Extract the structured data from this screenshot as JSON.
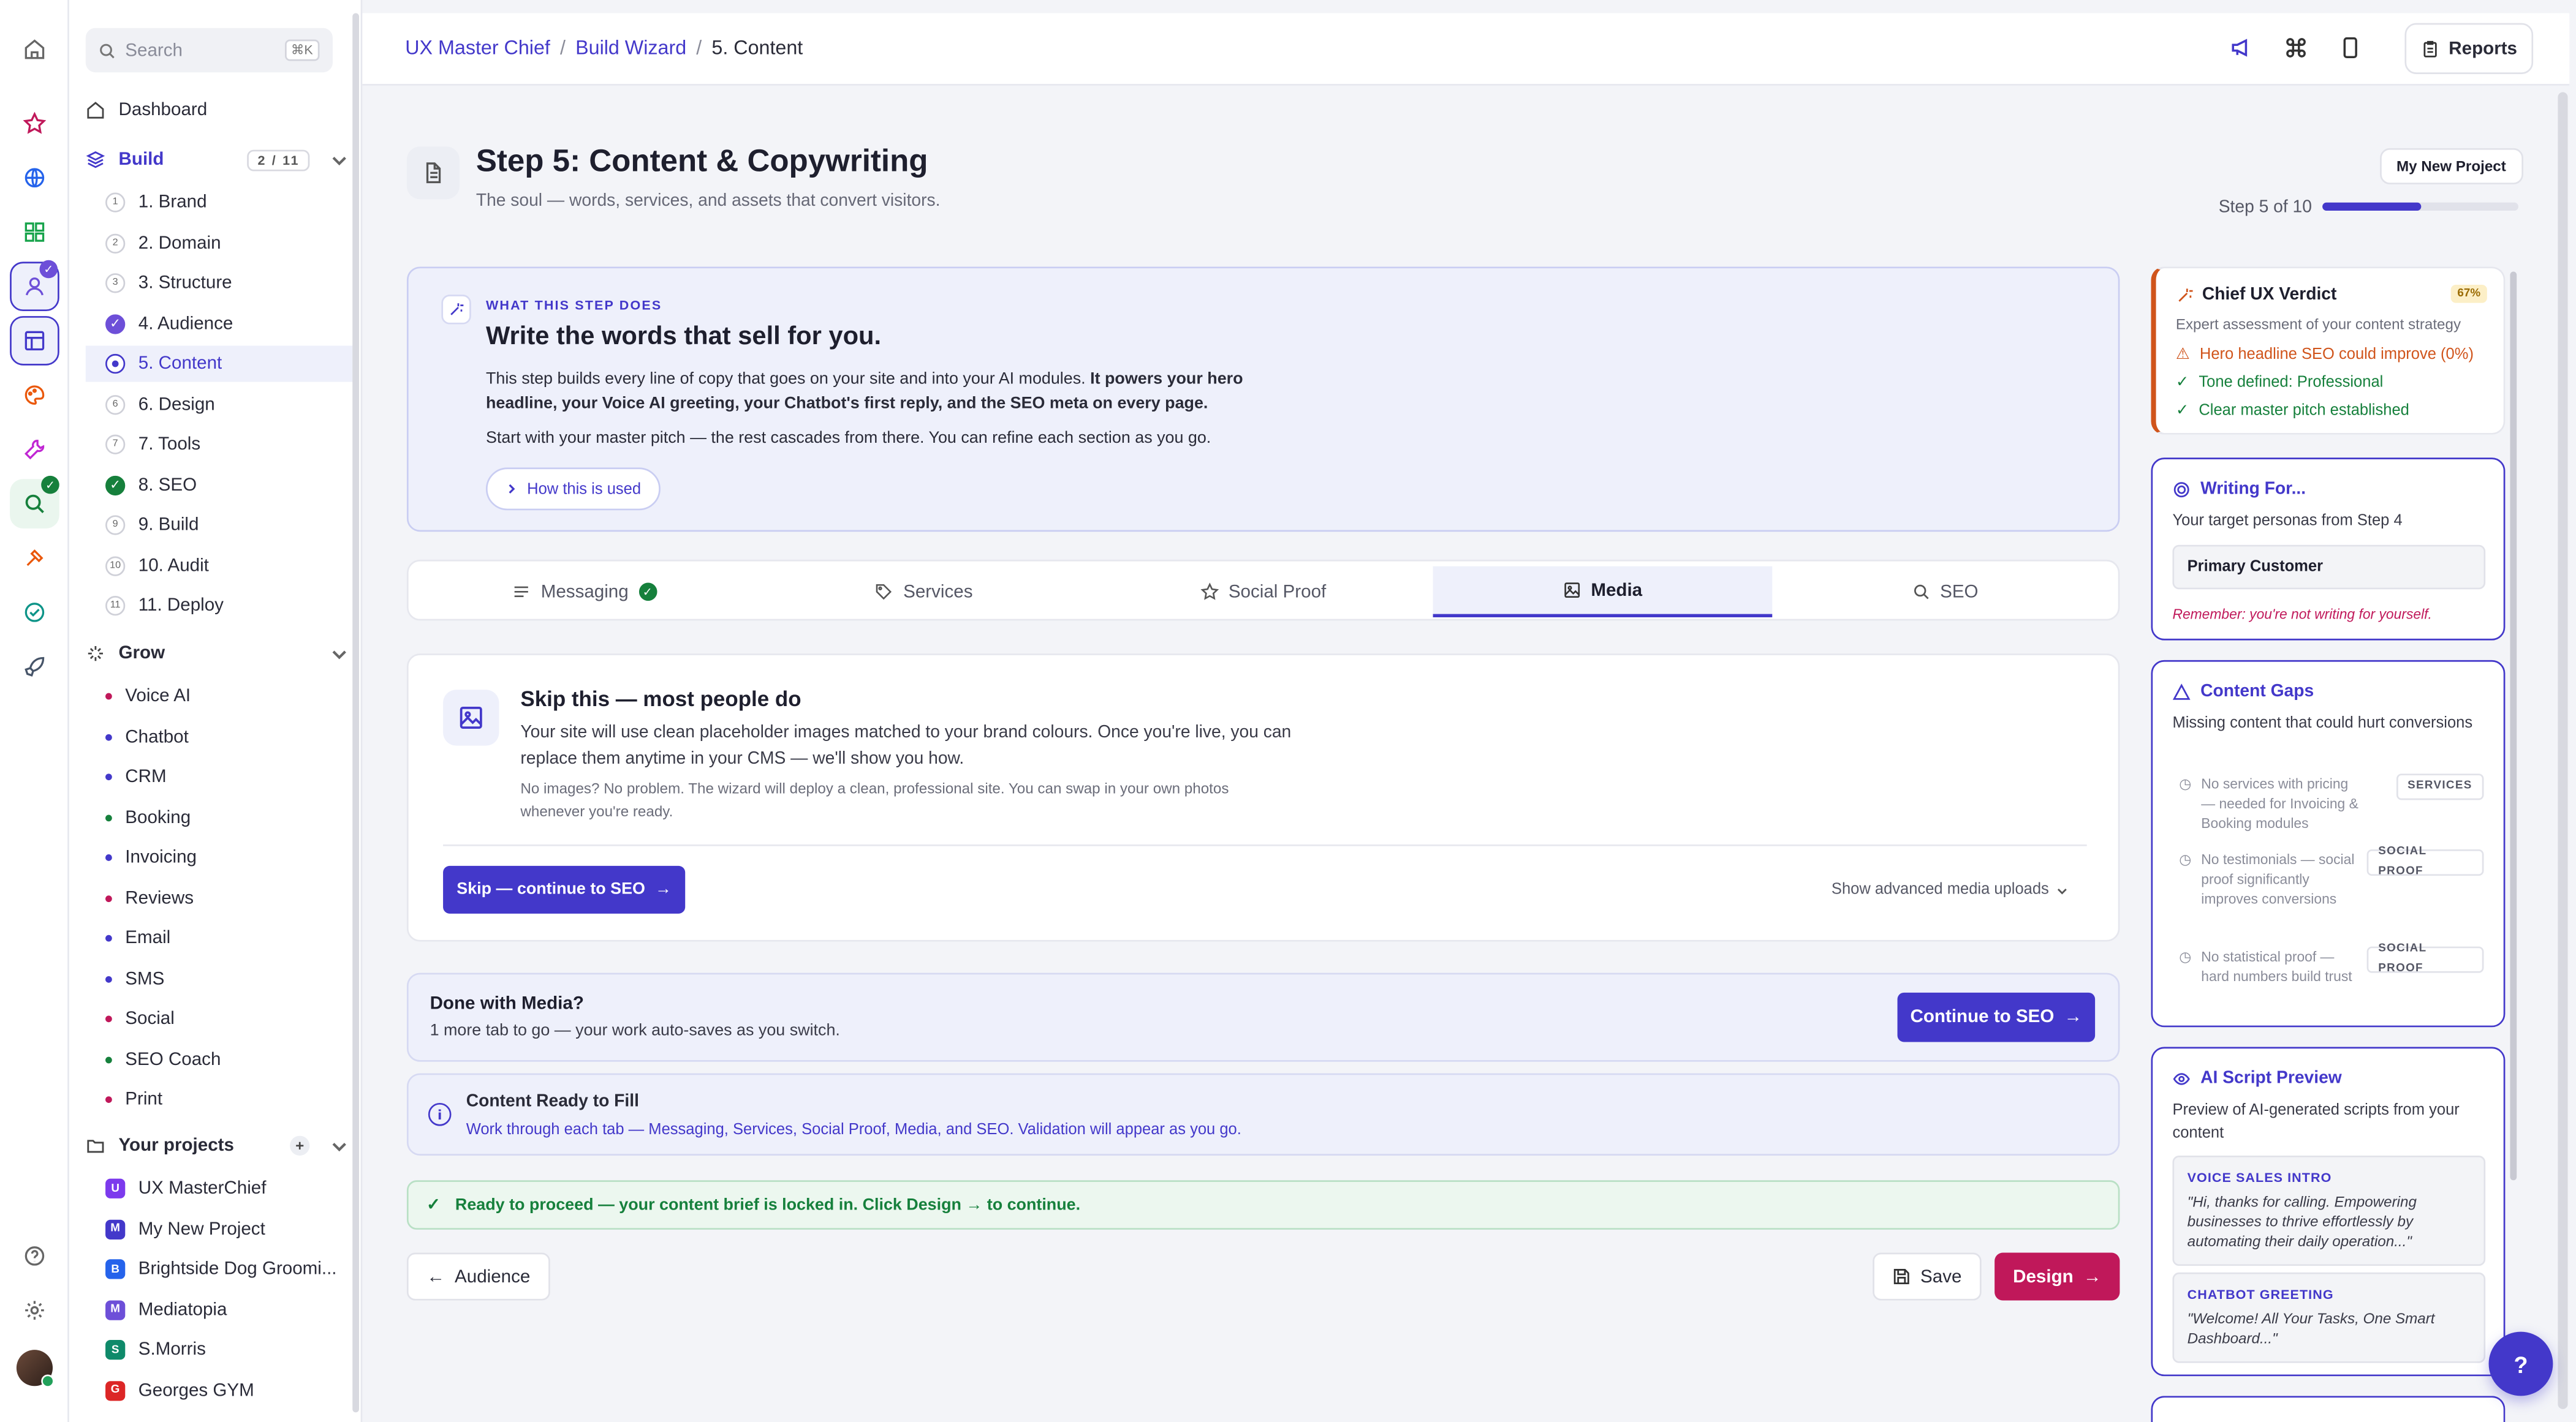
{
  "colors": {
    "accent": "#4338ca",
    "success": "#16803c",
    "danger": "#c0185a",
    "warning": "#d0541b",
    "bg": "#f3f4f8"
  },
  "search": {
    "placeholder": "Search",
    "shortcut": "⌘K"
  },
  "sidebar": {
    "dashboard": "Dashboard",
    "build": {
      "label": "Build",
      "count": "2 / 11"
    },
    "steps": [
      {
        "num": "1",
        "label": "1. Brand",
        "state": "todo"
      },
      {
        "num": "2",
        "label": "2. Domain",
        "state": "todo"
      },
      {
        "num": "3",
        "label": "3. Structure",
        "state": "todo"
      },
      {
        "num": "✓",
        "label": "4. Audience",
        "state": "done"
      },
      {
        "num": "",
        "label": "5. Content",
        "state": "current"
      },
      {
        "num": "6",
        "label": "6. Design",
        "state": "todo"
      },
      {
        "num": "7",
        "label": "7. Tools",
        "state": "todo"
      },
      {
        "num": "✓",
        "label": "8. SEO",
        "state": "done-green"
      },
      {
        "num": "9",
        "label": "9. Build",
        "state": "todo"
      },
      {
        "num": "10",
        "label": "10. Audit",
        "state": "todo"
      },
      {
        "num": "11",
        "label": "11. Deploy",
        "state": "todo"
      }
    ],
    "grow": {
      "label": "Grow",
      "items": [
        {
          "label": "Voice AI",
          "color": "#c0185a"
        },
        {
          "label": "Chatbot",
          "color": "#4338ca"
        },
        {
          "label": "CRM",
          "color": "#4338ca"
        },
        {
          "label": "Booking",
          "color": "#16803c"
        },
        {
          "label": "Invoicing",
          "color": "#4338ca"
        },
        {
          "label": "Reviews",
          "color": "#c0185a"
        },
        {
          "label": "Email",
          "color": "#4338ca"
        },
        {
          "label": "SMS",
          "color": "#4338ca"
        },
        {
          "label": "Social",
          "color": "#c0185a"
        },
        {
          "label": "SEO Coach",
          "color": "#16803c"
        },
        {
          "label": "Print",
          "color": "#c0185a"
        }
      ]
    },
    "projects": {
      "label": "Your projects",
      "add": "+",
      "items": [
        {
          "initial": "U",
          "label": "UX MasterChief",
          "color": "#7c3aed"
        },
        {
          "initial": "M",
          "label": "My New Project",
          "color": "#4338ca"
        },
        {
          "initial": "B",
          "label": "Brightside Dog Groomi...",
          "color": "#2563eb"
        },
        {
          "initial": "M",
          "label": "Mediatopia",
          "color": "#6d4fd8"
        },
        {
          "initial": "S",
          "label": "S.Morris",
          "color": "#0f8a6a"
        },
        {
          "initial": "G",
          "label": "Georges GYM",
          "color": "#dc2626"
        }
      ]
    }
  },
  "breadcrumb": {
    "root": "UX Master Chief",
    "mid": "Build Wizard",
    "current": "5. Content",
    "sep": "/"
  },
  "topbar": {
    "reports": "Reports"
  },
  "header": {
    "title": "Step 5: Content & Copywriting",
    "subtitle": "The soul — words, services, and assets that convert visitors.",
    "project": "My New Project",
    "step_of": "Step 5 of 10",
    "progress": 0.5
  },
  "info": {
    "eyebrow": "WHAT THIS STEP DOES",
    "title": "Write the words that sell for you.",
    "p1_start": "This step builds every line of copy that goes on your site and into your AI modules. ",
    "p1_bold": "It powers your hero headline, your Voice AI greeting, your Chatbot's first reply, and the SEO meta on every page.",
    "p2": "Start with your master pitch — the rest cascades from there. You can refine each section as you go.",
    "how": "How this is used"
  },
  "tabs": [
    {
      "label": "Messaging",
      "icon": "lines-icon",
      "checked": true
    },
    {
      "label": "Services",
      "icon": "tag-icon"
    },
    {
      "label": "Social Proof",
      "icon": "star-icon"
    },
    {
      "label": "Media",
      "icon": "image-icon",
      "active": true
    },
    {
      "label": "SEO",
      "icon": "search-icon"
    }
  ],
  "media": {
    "title": "Skip this — most people do",
    "p": "Your site will use clean placeholder images matched to your brand colours. Once you're live, you can replace them anytime in your CMS — we'll show you how.",
    "p2": "No images? No problem. The wizard will deploy a clean, professional site. You can swap in your own photos whenever you're ready.",
    "skip": "Skip — continue to SEO",
    "advanced": "Show advanced media uploads"
  },
  "done": {
    "title": "Done with Media?",
    "sub": "1 more tab to go — your work auto-saves as you switch.",
    "cta": "Continue to SEO"
  },
  "ready": {
    "title": "Content Ready to Fill",
    "sub": "Work through each tab — Messaging, Services, Social Proof, Media, and SEO. Validation will appear as you go."
  },
  "proceed": "Ready to proceed — your content brief is locked in. Click Design → to continue.",
  "footer": {
    "back": "Audience",
    "save": "Save",
    "next": "Design"
  },
  "verdict": {
    "title": "Chief UX Verdict",
    "pct": "67%",
    "sub": "Expert assessment of your content strategy",
    "items": [
      {
        "text": "Hero headline SEO could improve (0%)",
        "type": "warn"
      },
      {
        "text": "Tone defined: Professional",
        "type": "ok"
      },
      {
        "text": "Clear master pitch established",
        "type": "ok"
      }
    ]
  },
  "writing": {
    "title": "Writing For...",
    "sub": "Your target personas from Step 4",
    "persona": "Primary Customer",
    "remind": "Remember: you're not writing for yourself."
  },
  "gaps": {
    "title": "Content Gaps",
    "sub": "Missing content that could hurt conversions",
    "items": [
      {
        "text": "No services with pricing — needed for Invoicing & Booking modules",
        "tag": "SERVICES"
      },
      {
        "text": "No testimonials — social proof significantly improves conversions",
        "tag": "SOCIAL PROOF"
      },
      {
        "text": "No statistical proof — hard numbers build trust",
        "tag": "SOCIAL PROOF"
      }
    ]
  },
  "ai": {
    "title": "AI Script Preview",
    "sub": "Preview of AI-generated scripts from your content",
    "scripts": [
      {
        "title": "VOICE SALES INTRO",
        "body": "\"Hi, thanks for calling. Empowering businesses to thrive effortlessly by automating their daily operation...\""
      },
      {
        "title": "CHATBOT GREETING",
        "body": "\"Welcome! All Your Tasks, One Smart Dashboard...\""
      }
    ]
  },
  "help": "?"
}
